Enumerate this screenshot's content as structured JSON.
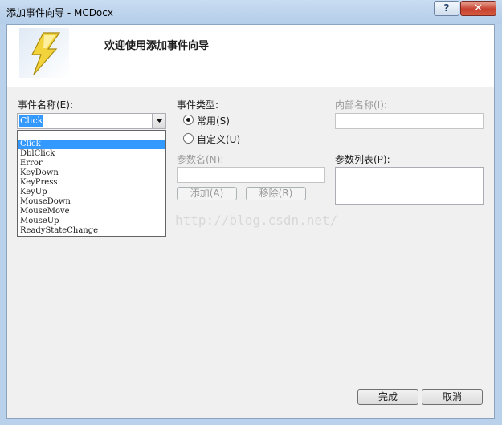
{
  "window": {
    "title": "添加事件向导 - MCDocx",
    "help_label": "?",
    "close_label": "✕"
  },
  "header": {
    "text": "欢迎使用添加事件向导",
    "icon": "lightning-icon"
  },
  "event_name": {
    "label": "事件名称(E):",
    "value": "Click",
    "options": [
      "Click",
      "DblClick",
      "Error",
      "KeyDown",
      "KeyPress",
      "KeyUp",
      "MouseDown",
      "MouseMove",
      "MouseUp",
      "ReadyStateChange"
    ],
    "selected": "Click"
  },
  "event_type": {
    "label": "事件类型:",
    "common_label": "常用(S)",
    "custom_label": "自定义(U)",
    "selected": "common"
  },
  "internal_name": {
    "label": "内部名称(I):",
    "value": ""
  },
  "param_name": {
    "label": "参数名(N):",
    "value": ""
  },
  "param_list": {
    "label": "参数列表(P):"
  },
  "buttons": {
    "add": "添加(A)",
    "remove": "移除(R)",
    "finish": "完成",
    "cancel": "取消"
  },
  "watermark": "http://blog.csdn.net/",
  "colors": {
    "selection": "#3399ff",
    "title_bar": "#b9d1ea",
    "dialog_bg": "#f0f0f0",
    "close_button": "#c7402f"
  }
}
